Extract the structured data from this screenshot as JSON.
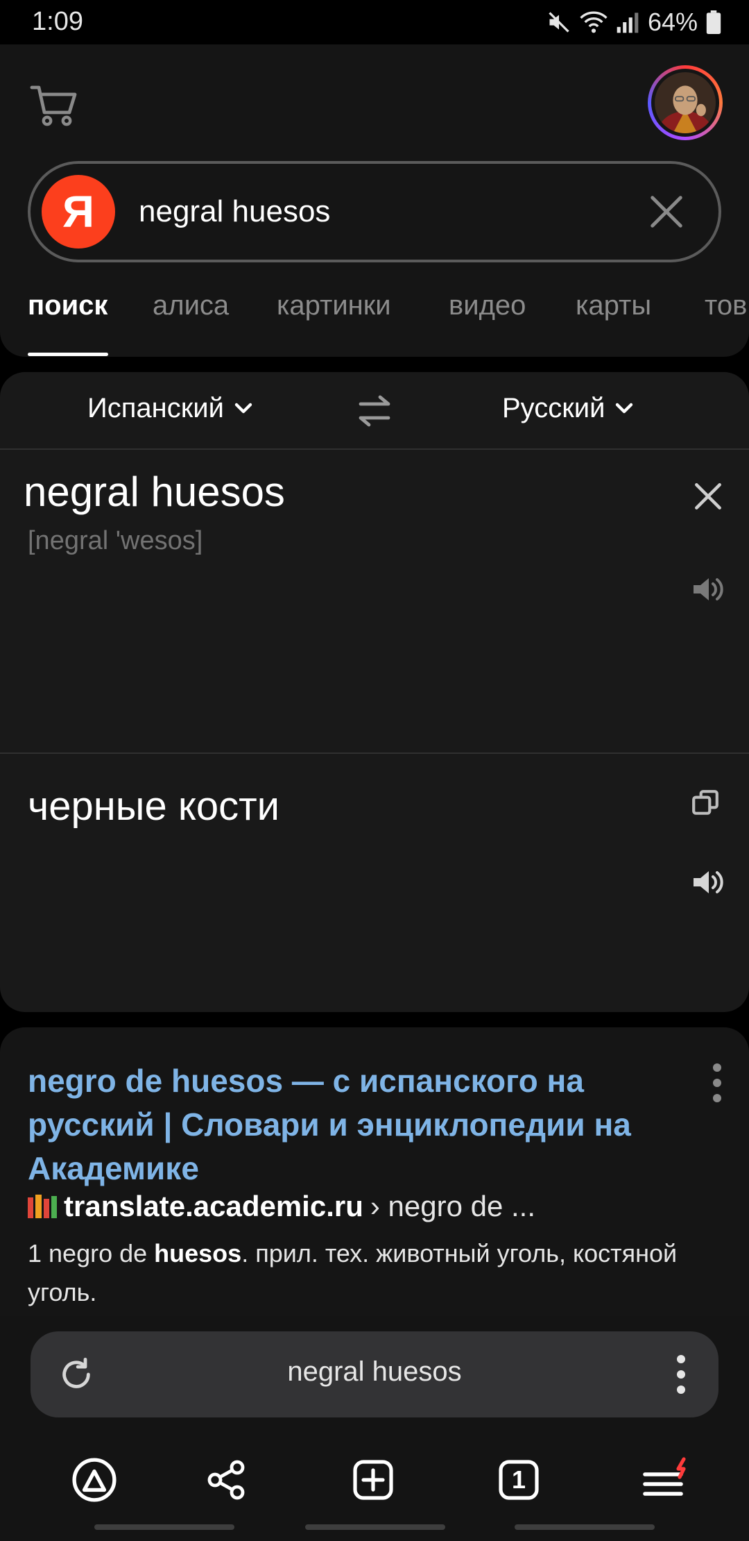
{
  "status_bar": {
    "time": "1:09",
    "battery": "64%"
  },
  "header": {
    "search_query": "negral huesos",
    "logo_letter": "Я",
    "tabs": [
      {
        "label": "поиск",
        "active": true
      },
      {
        "label": "алиса",
        "active": false
      },
      {
        "label": "картинки",
        "active": false
      },
      {
        "label": "видео",
        "active": false
      },
      {
        "label": "карты",
        "active": false
      },
      {
        "label": "тов",
        "active": false
      }
    ]
  },
  "translator": {
    "source_lang": "Испанский",
    "target_lang": "Русский",
    "source_text": "negral huesos",
    "transliteration": "[negral 'wesos]",
    "translation": "черные кости"
  },
  "result": {
    "title": "negro de huesos — с испанского на русский | Словари и энциклопедии на Академике",
    "domain": "translate.academic.ru",
    "path": "› negro de ...",
    "snippet_prefix": "1 negro de ",
    "snippet_bold": "huesos",
    "snippet_suffix": ". прил. тех. животный уголь, костяной уголь."
  },
  "bottom_bar": {
    "url_text": "negral huesos",
    "tab_count": "1"
  },
  "colors": {
    "yandex_red": "#fc3f1d",
    "link_blue": "#7fb4e6",
    "notification_red": "#ff3b3b"
  },
  "icons": [
    "cart-icon",
    "close-icon",
    "swap-icon",
    "chevron-down-icon",
    "speaker-icon",
    "copy-icon",
    "more-vert-icon",
    "reload-icon",
    "alice-icon",
    "share-icon",
    "new-tab-icon",
    "tabs-icon",
    "menu-icon"
  ]
}
